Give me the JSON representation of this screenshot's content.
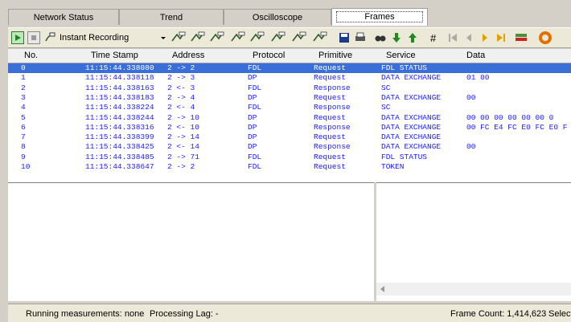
{
  "tabs": [
    {
      "label": "Network Status"
    },
    {
      "label": "Trend"
    },
    {
      "label": "Oscilloscope"
    },
    {
      "label": "Frames",
      "active": true
    }
  ],
  "toolbar": {
    "recording_label": "Instant Recording",
    "icons": [
      "play-icon",
      "stop-icon",
      "record-icon",
      "dropdown-arrow-icon",
      "filter-icon",
      "filter-icon",
      "filter-icon",
      "filter-icon",
      "filter-icon",
      "filter-icon",
      "filter-icon",
      "filter-icon",
      "save-icon",
      "print-icon",
      "find-icon",
      "arrow-down-icon",
      "arrow-up-icon",
      "frame-number-icon",
      "first-icon",
      "prev-icon",
      "next-icon",
      "last-icon",
      "color-icon",
      "palette-icon"
    ]
  },
  "table": {
    "columns": [
      "No.",
      "Time Stamp",
      "Address",
      "Protocol",
      "Primitive",
      "Service",
      "Data"
    ],
    "rows": [
      [
        "0",
        "11:15:44.338080",
        "2 -> 2",
        "FDL",
        "Request",
        "FDL STATUS",
        ""
      ],
      [
        "1",
        "11:15:44.338118",
        "2 -> 3",
        "DP",
        "Request",
        "DATA EXCHANGE",
        "01 00"
      ],
      [
        "2",
        "11:15:44.338163",
        "2 <- 3",
        "FDL",
        "Response",
        "SC",
        ""
      ],
      [
        "3",
        "11:15:44.338183",
        "2 -> 4",
        "DP",
        "Request",
        "DATA EXCHANGE",
        "00"
      ],
      [
        "4",
        "11:15:44.338224",
        "2 <- 4",
        "FDL",
        "Response",
        "SC",
        ""
      ],
      [
        "5",
        "11:15:44.338244",
        "2 -> 10",
        "DP",
        "Request",
        "DATA EXCHANGE",
        "00 00 00 00 00 00 0"
      ],
      [
        "6",
        "11:15:44.338316",
        "2 <- 10",
        "DP",
        "Response",
        "DATA EXCHANGE",
        "00 FC E4 FC E0 FC E0 F"
      ],
      [
        "7",
        "11:15:44.338399",
        "2 -> 14",
        "DP",
        "Request",
        "DATA EXCHANGE",
        ""
      ],
      [
        "8",
        "11:15:44.338425",
        "2 <- 14",
        "DP",
        "Response",
        "DATA EXCHANGE",
        "00"
      ],
      [
        "9",
        "11:15:44.338485",
        "2 -> 71",
        "FDL",
        "Request",
        "FDL STATUS",
        ""
      ],
      [
        "10",
        "11:15:44.338647",
        "2 -> 2",
        "FDL",
        "Request",
        "TOKEN",
        ""
      ]
    ],
    "selected_row": 0
  },
  "status": {
    "measurements": "Running measurements: none",
    "lag": "Processing Lag: -",
    "frame_count": "Frame Count: 1,414,623",
    "select": "Select"
  },
  "colors": {
    "row_text": "#1a1aff",
    "selected_bg": "#3a6fd8"
  }
}
